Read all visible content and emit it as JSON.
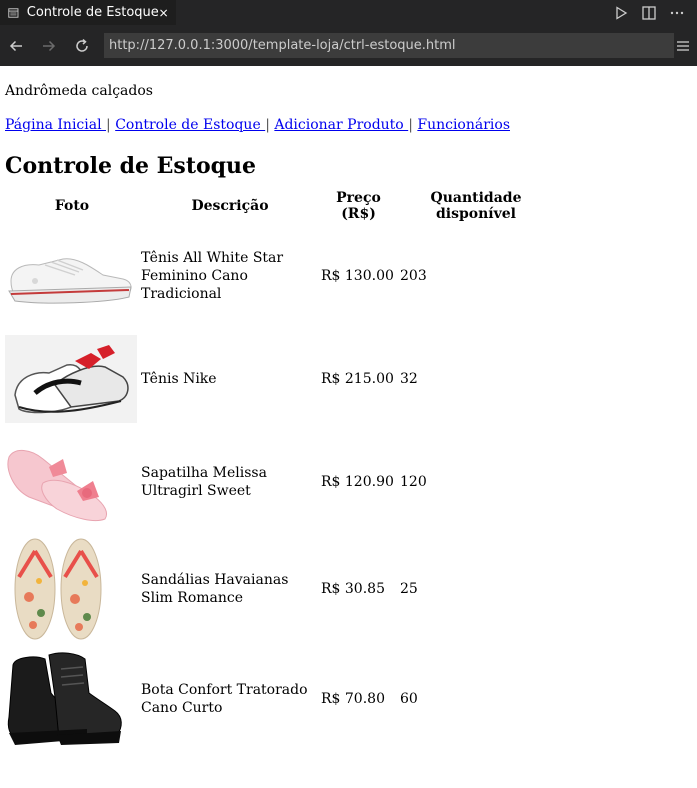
{
  "browser": {
    "tab_title": "Controle de Estoque",
    "url": "http://127.0.0.1:3000/template-loja/ctrl-estoque.html"
  },
  "page": {
    "brand": "Andrômeda calçados",
    "nav": [
      {
        "label": "Página Inicial "
      },
      {
        "label": "Controle de Estoque "
      },
      {
        "label": "Adicionar Produto "
      },
      {
        "label": "Funcionários"
      }
    ],
    "separator": " | ",
    "heading": "Controle de Estoque",
    "table": {
      "headers": [
        "Foto",
        "Descrição",
        "Preço (R$)",
        "Quantidade disponível"
      ],
      "rows": [
        {
          "descricao": "Tênis All White Star Feminino Cano Tradicional",
          "preco": "R$ 130.00",
          "quantidade": "203"
        },
        {
          "descricao": "Tênis Nike",
          "preco": "R$ 215.00",
          "quantidade": "32"
        },
        {
          "descricao": "Sapatilha Melissa Ultragirl Sweet",
          "preco": "R$ 120.90",
          "quantidade": "120"
        },
        {
          "descricao": "Sandálias Havaianas Slim Romance",
          "preco": "R$ 30.85",
          "quantidade": "25"
        },
        {
          "descricao": "Bota Confort Tratorado Cano Curto",
          "preco": "R$ 70.80",
          "quantidade": "60"
        }
      ]
    }
  },
  "colors": {
    "chrome_bg": "#252526",
    "url_bg": "#3c3c3c",
    "link": "#0000ee"
  },
  "icons": [
    "browser-tab-icon",
    "close-icon",
    "run-icon",
    "split-icon",
    "more-icon",
    "back-icon",
    "forward-icon",
    "reload-icon",
    "menu-icon"
  ]
}
